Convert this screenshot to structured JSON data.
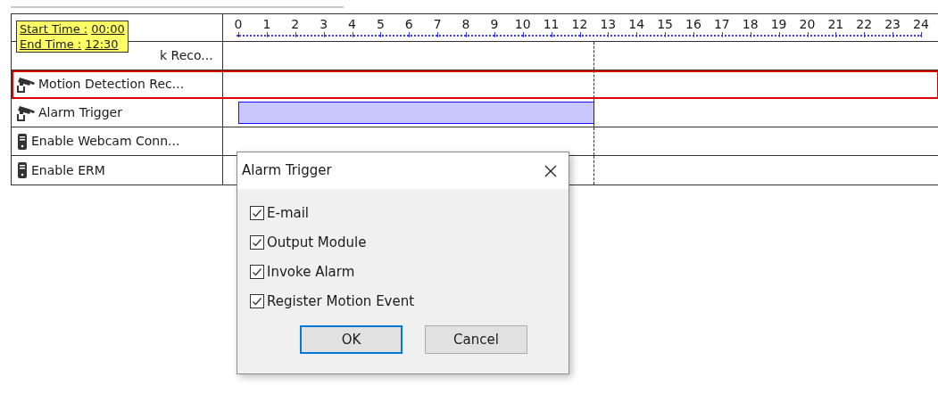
{
  "tooltip": {
    "lines": [
      {
        "label": "Start Time :",
        "time": "00:00"
      },
      {
        "label": "End Time :",
        "time": "12:30"
      }
    ]
  },
  "ruler": [
    "0",
    "1",
    "2",
    "3",
    "4",
    "5",
    "6",
    "7",
    "8",
    "9",
    "10",
    "11",
    "12",
    "13",
    "14",
    "15",
    "16",
    "17",
    "18",
    "19",
    "20",
    "21",
    "22",
    "23",
    "24"
  ],
  "rows": [
    {
      "label": "k Reco...",
      "selected": false
    },
    {
      "label": "Motion Detection Rec...",
      "kind": "camera",
      "selected": true
    },
    {
      "label": "Alarm Trigger",
      "kind": "camera",
      "selected": false,
      "scheduled": true
    },
    {
      "label": "Enable Webcam Conn...",
      "kind": "device",
      "selected": false
    },
    {
      "label": "Enable ERM",
      "kind": "device",
      "selected": false
    }
  ],
  "dialog": {
    "title": "Alarm Trigger",
    "options": [
      {
        "label": "E-mail",
        "checked": true
      },
      {
        "label": "Output Module",
        "checked": true
      },
      {
        "label": "Invoke Alarm",
        "checked": true
      },
      {
        "label": "Register Motion Event",
        "checked": true
      }
    ],
    "buttons": [
      {
        "label": "OK",
        "selected": true
      },
      {
        "label": "Cancel",
        "selected": false
      }
    ]
  }
}
